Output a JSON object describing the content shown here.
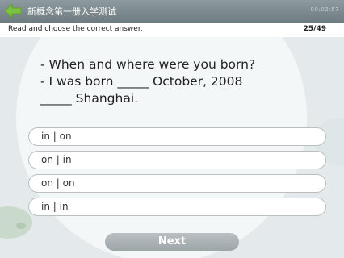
{
  "header": {
    "title": "新概念第一册入学测试",
    "clock": "00:02:57"
  },
  "subheader": {
    "instruction": "Read and choose the correct answer.",
    "progress": "25/49"
  },
  "question": {
    "lines": [
      "- When and where were you born?",
      "- I was born _____ October, 2008",
      "_____ Shanghai."
    ]
  },
  "options": [
    {
      "label": "in | on"
    },
    {
      "label": "on | in"
    },
    {
      "label": "on | on"
    },
    {
      "label": "in | in"
    }
  ],
  "next_label": "Next",
  "colors": {
    "titlebar": "#7d8a8f",
    "back_arrow": "#7cc143"
  },
  "icons": {
    "back": "arrow-left-icon"
  }
}
